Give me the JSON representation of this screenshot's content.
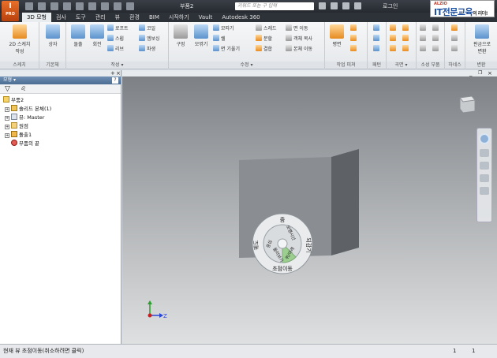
{
  "app": {
    "logo": "I",
    "logo_sub": "PRO",
    "doc_title": "부품2",
    "search_placeholder": "키워드 또는 구 입력",
    "login": "로그인"
  },
  "ad": {
    "top": "ALZIO",
    "brand": "IT전문교육",
    "tail": "의 리더!"
  },
  "tabs": [
    "3D 모형",
    "검사",
    "도구",
    "관리",
    "뷰",
    "환경",
    "BIM",
    "시작하기",
    "Vault",
    "Autodesk 360"
  ],
  "ribbon": {
    "sketch": {
      "title": "스케치",
      "btn": "2D 스케치\n작성"
    },
    "primitives": {
      "title": "기본체",
      "btn": "상자"
    },
    "create": {
      "title": "작성 ▾",
      "extrude": "돌출",
      "revolve": "회전",
      "loft": "로프트",
      "coil": "코일",
      "sweep": "스윕",
      "emboss": "엠보싱",
      "rib": "리브",
      "derive": "파생"
    },
    "modify": {
      "title": "수정 ▾",
      "hole": "구멍",
      "fillet": "모깎기",
      "chamfer": "모따기",
      "shell": "쉘",
      "draft": "면 기울기",
      "thread": "스레드",
      "combine": "분할",
      "join": "결합",
      "move_face": "면 이동",
      "copy": "객체 복사",
      "move_body": "본체 이동"
    },
    "work_features": {
      "title": "작업 피쳐",
      "btn": "평면"
    },
    "pattern": {
      "title": "패턴"
    },
    "surface": {
      "title": "곡면 ▾"
    },
    "plastic": {
      "title": "소성 부품"
    },
    "harness": {
      "title": "하네스"
    },
    "convert": {
      "title": "변환",
      "btn": "판금으로\n변환"
    }
  },
  "browser": {
    "tab": "모형 ▾",
    "items": [
      {
        "label": "부품2"
      },
      {
        "label": "솔리드 본체(1)"
      },
      {
        "label": "뷰: Master"
      },
      {
        "label": "원점"
      },
      {
        "label": "돌출1"
      },
      {
        "label": "부품의 끝"
      }
    ]
  },
  "wheel": {
    "top": "줌",
    "left": "궤도",
    "right": "되감기",
    "bottom": "초점이동",
    "inner_left": "중심",
    "inner_top": "보행시선",
    "inner_right": "위/아래",
    "inner_bottom": "둘러보기"
  },
  "axes": {
    "z": "Z"
  },
  "status": {
    "message": "현재 뷰 초점이동(취소하려면 클릭)",
    "n1": "1",
    "n2": "1"
  }
}
